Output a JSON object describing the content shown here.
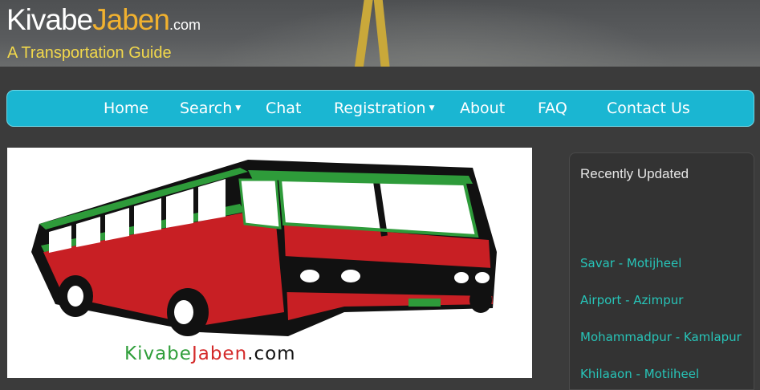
{
  "site": {
    "logo_part1": "Kivabe",
    "logo_part2": "Jaben",
    "logo_suffix": ".com",
    "tagline": "A Transportation Guide"
  },
  "nav": {
    "items": [
      {
        "label": "Home",
        "dropdown": false
      },
      {
        "label": "Search",
        "dropdown": true
      },
      {
        "label": "Chat",
        "dropdown": false
      },
      {
        "label": "Registration",
        "dropdown": true
      },
      {
        "label": "About",
        "dropdown": false
      },
      {
        "label": "FAQ",
        "dropdown": false
      },
      {
        "label": "Contact Us",
        "dropdown": false
      }
    ]
  },
  "hero": {
    "brand_part1": "Kivabe",
    "brand_part2": "Jaben",
    "brand_part3": ".com"
  },
  "sidebar": {
    "title": "Recently Updated",
    "routes": [
      "Savar - Motijheel",
      "Airport - Azimpur",
      "Mohammadpur - Kamlapur",
      "Khilaaon - Motiiheel"
    ]
  },
  "colors": {
    "nav_bg": "#1ab6d2",
    "route_link": "#27c4b8",
    "logo_accent": "#f1b12f",
    "tagline": "#f2d84b",
    "bus_body": "#c81f24",
    "bus_trim": "#2e9b3a"
  }
}
